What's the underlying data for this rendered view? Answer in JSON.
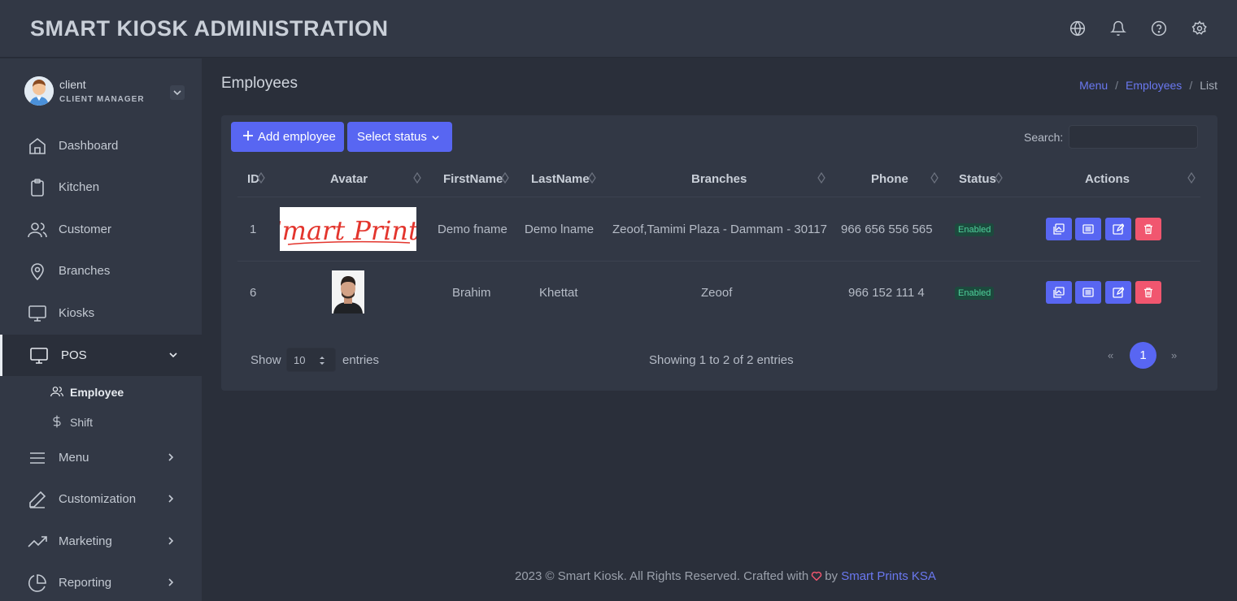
{
  "app": {
    "title": "SMART KIOSK ADMINISTRATION"
  },
  "topbar": {
    "icons": [
      "globe-icon",
      "bell-icon",
      "help-icon",
      "settings-icon"
    ]
  },
  "user": {
    "name": "client",
    "role": "CLIENT MANAGER"
  },
  "sidebar": {
    "items": [
      {
        "label": "Dashboard",
        "icon": "home-icon"
      },
      {
        "label": "Kitchen",
        "icon": "clipboard-icon"
      },
      {
        "label": "Customer",
        "icon": "users-icon"
      },
      {
        "label": "Branches",
        "icon": "map-pin-icon"
      },
      {
        "label": "Kiosks",
        "icon": "monitor-icon"
      },
      {
        "label": "POS",
        "icon": "monitor-icon",
        "expanded": true
      },
      {
        "label": "Menu",
        "icon": "menu-icon"
      },
      {
        "label": "Customization",
        "icon": "pen-icon"
      },
      {
        "label": "Marketing",
        "icon": "trending-up-icon"
      },
      {
        "label": "Reporting",
        "icon": "pie-chart-icon"
      }
    ],
    "pos_sub": [
      {
        "label": "Employee",
        "icon": "users-icon",
        "active": true
      },
      {
        "label": "Shift",
        "icon": "dollar-icon"
      }
    ]
  },
  "page": {
    "title": "Employees"
  },
  "breadcrumb": {
    "items": [
      "Menu",
      "Employees",
      "List"
    ],
    "sep": "/"
  },
  "toolbar": {
    "add_label": "Add employee",
    "status_label": "Select status",
    "search_label": "Search:",
    "search_value": ""
  },
  "table": {
    "columns": [
      "ID",
      "Avatar",
      "FirstName",
      "LastName",
      "Branches",
      "Phone",
      "Status",
      "Actions"
    ],
    "rows": [
      {
        "id": "1",
        "avatar_text": "Smart Prints",
        "first": "Demo fname",
        "last": "Demo lname",
        "branches": "Zeoof,Tamimi Plaza - Dammam - 30117",
        "phone": "966 656 556 565",
        "status": "Enabled"
      },
      {
        "id": "6",
        "avatar_text": "",
        "first": "Brahim",
        "last": "Khettat",
        "branches": "Zeoof",
        "phone": "966 152 111 4",
        "status": "Enabled"
      }
    ],
    "actions": [
      "gallery-icon",
      "list-icon",
      "edit-icon",
      "trash-icon"
    ]
  },
  "pagination": {
    "show": "Show",
    "length": "10",
    "entries": "entries",
    "info": "Showing 1 to 2 of 2 entries",
    "prev": "«",
    "current": "1",
    "next": "»"
  },
  "footer": {
    "text": "2023 © Smart Kiosk. All Rights Reserved. Crafted with",
    "by": "by",
    "link": "Smart Prints KSA"
  },
  "colors": {
    "accent": "#5866f2",
    "danger": "#f1566f",
    "success": "#4fd19c",
    "bg": "#2a2f3a",
    "panel": "#323845"
  }
}
